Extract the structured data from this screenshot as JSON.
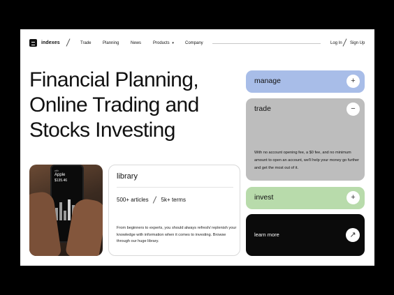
{
  "nav": {
    "logo": "indexes",
    "items": [
      "Trade",
      "Planning",
      "News",
      "Products",
      "Company"
    ],
    "products_chevron": "▾",
    "login": "Log In",
    "signup": "Sign Up"
  },
  "hero": {
    "lines": [
      "Financial Planning,",
      "Online Trading and",
      "Stocks Investing"
    ]
  },
  "phone": {
    "label": "with",
    "name": "Apple",
    "price": "$135.46"
  },
  "library": {
    "title": "library",
    "articles": "500+ articles",
    "terms": "5k+ terms",
    "description": "From beginners to experts, you should always refresh/ replenish your knowledge with information when it comes to investing. Browse through our huge library."
  },
  "cards": {
    "manage": {
      "label": "manage",
      "icon": "+"
    },
    "trade": {
      "label": "trade",
      "icon": "−",
      "description": "With no account opening fee, a $0 fee, and no minimum amount to open an account, we'll help your money go further and get the most out of it."
    },
    "invest": {
      "label": "invest",
      "icon": "+"
    },
    "learn": {
      "label": "learn more",
      "icon": "↗"
    }
  },
  "colors": {
    "manage": "#a8bde8",
    "trade": "#bdbdbd",
    "invest": "#b8dbab",
    "learn": "#0b0b0b"
  }
}
